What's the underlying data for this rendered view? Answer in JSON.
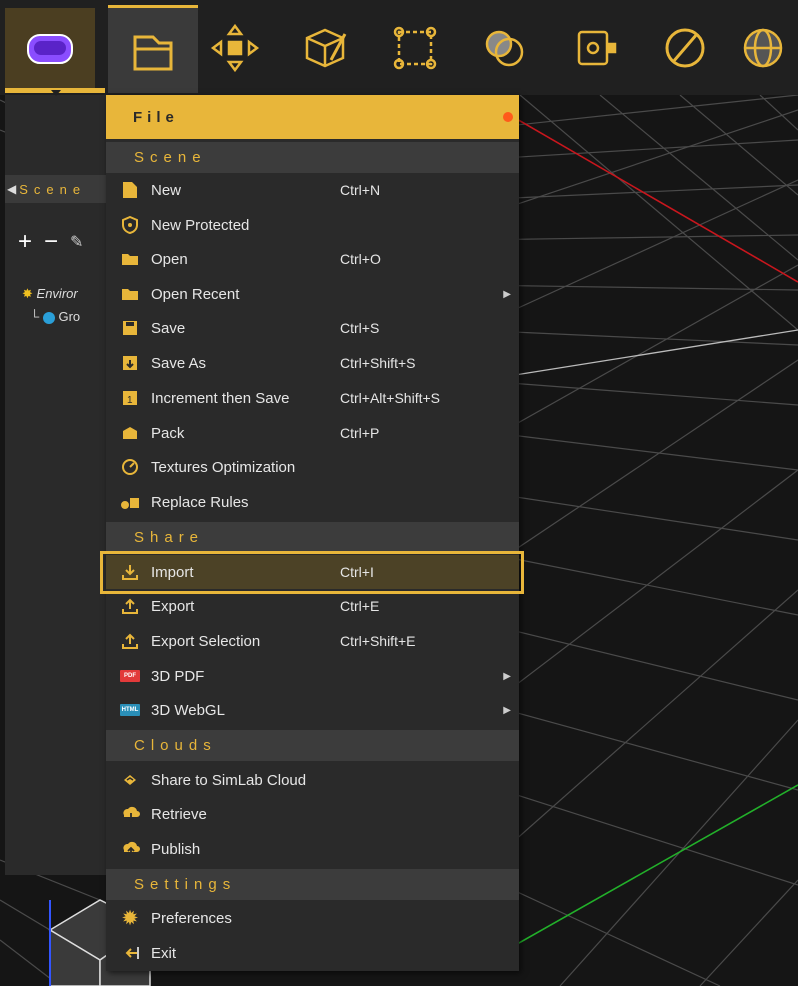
{
  "scene_panel": {
    "tab_label": "Scene",
    "tree_items": [
      "Enviror",
      "Gro"
    ]
  },
  "menu": {
    "title": "File",
    "sections": {
      "scene": "Scene",
      "share": "Share",
      "clouds": "Clouds",
      "settings": "Settings"
    },
    "items": [
      {
        "id": "new",
        "label": "New",
        "shortcut": "Ctrl+N",
        "icon": "new-file-icon"
      },
      {
        "id": "new-protected",
        "label": "New Protected",
        "shortcut": "",
        "icon": "shield-icon"
      },
      {
        "id": "open",
        "label": "Open",
        "shortcut": "Ctrl+O",
        "icon": "folder-icon"
      },
      {
        "id": "open-recent",
        "label": "Open Recent",
        "shortcut": "",
        "icon": "folder-icon",
        "submenu": true
      },
      {
        "id": "save",
        "label": "Save",
        "shortcut": "Ctrl+S",
        "icon": "save-icon"
      },
      {
        "id": "save-as",
        "label": "Save As",
        "shortcut": "Ctrl+Shift+S",
        "icon": "save-as-icon"
      },
      {
        "id": "increment-save",
        "label": "Increment then Save",
        "shortcut": "Ctrl+Alt+Shift+S",
        "icon": "increment-save-icon"
      },
      {
        "id": "pack",
        "label": "Pack",
        "shortcut": "Ctrl+P",
        "icon": "pack-icon"
      },
      {
        "id": "textures-opt",
        "label": "Textures Optimization",
        "shortcut": "",
        "icon": "gauge-icon"
      },
      {
        "id": "replace-rules",
        "label": "Replace Rules",
        "shortcut": "",
        "icon": "replace-icon"
      },
      {
        "id": "import",
        "label": "Import",
        "shortcut": "Ctrl+I",
        "icon": "import-icon"
      },
      {
        "id": "export",
        "label": "Export",
        "shortcut": "Ctrl+E",
        "icon": "export-icon"
      },
      {
        "id": "export-selection",
        "label": "Export Selection",
        "shortcut": "Ctrl+Shift+E",
        "icon": "export-icon"
      },
      {
        "id": "3d-pdf",
        "label": "3D PDF",
        "shortcut": "",
        "icon": "pdf-badge-icon",
        "badge": "PDF",
        "submenu": true
      },
      {
        "id": "3d-webgl",
        "label": "3D WebGL",
        "shortcut": "",
        "icon": "html-badge-icon",
        "badge": "HTML",
        "submenu": true
      },
      {
        "id": "share-cloud",
        "label": "Share to SimLab Cloud",
        "shortcut": "",
        "icon": "cloud-share-icon"
      },
      {
        "id": "retrieve",
        "label": "Retrieve",
        "shortcut": "",
        "icon": "cloud-download-icon"
      },
      {
        "id": "publish",
        "label": "Publish",
        "shortcut": "",
        "icon": "cloud-upload-icon"
      },
      {
        "id": "preferences",
        "label": "Preferences",
        "shortcut": "",
        "icon": "gear-icon"
      },
      {
        "id": "exit",
        "label": "Exit",
        "shortcut": "",
        "icon": "exit-icon"
      }
    ]
  },
  "colors": {
    "accent": "#e8b63a",
    "menu_bg": "#2a2a2a",
    "section_bg": "#3c3c3c",
    "highlight_bg": "#4c4226",
    "vr_icon": "#8a4dff",
    "axis_red": "#c8161d",
    "axis_green": "#22b02a"
  }
}
